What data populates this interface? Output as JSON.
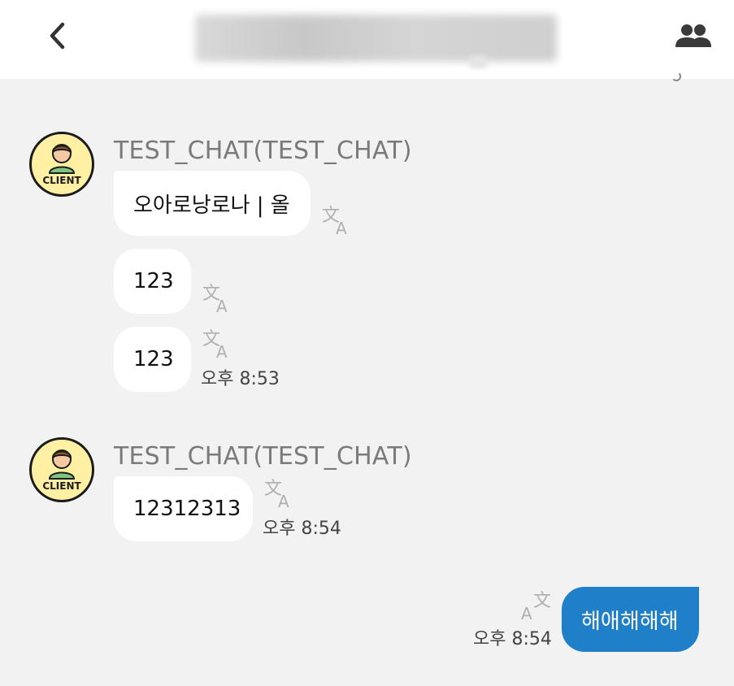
{
  "header": {
    "back_icon": "chevron-left-icon",
    "members_icon": "group-icon"
  },
  "groups": [
    {
      "sender": "TEST_CHAT(TEST_CHAT)",
      "avatar_label": "CLIENT",
      "messages": [
        {
          "text": "오아로낭로나 | 올"
        },
        {
          "text": "123"
        },
        {
          "text": "123",
          "time": "오후 8:53"
        }
      ]
    },
    {
      "sender": "TEST_CHAT(TEST_CHAT)",
      "avatar_label": "CLIENT",
      "messages": [
        {
          "text": "12312313",
          "time": "오후 8:54"
        }
      ]
    }
  ],
  "mine": {
    "text": "해애해해해",
    "time": "오후 8:54"
  },
  "colors": {
    "header_bg": "#ffffff",
    "chat_bg": "#f2f2f2",
    "incoming_bubble": "#ffffff",
    "outgoing_bubble": "#1f7fc8",
    "avatar_bg": "#fff0a3"
  }
}
